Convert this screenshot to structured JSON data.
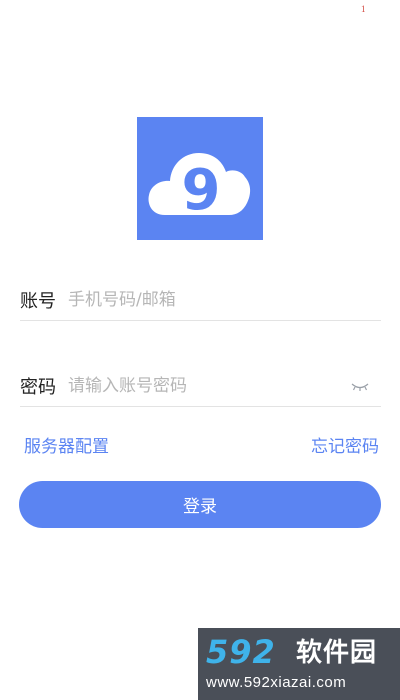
{
  "status": {
    "corner_mark": "1"
  },
  "logo": {
    "icon": "cloud-icon",
    "glyph": "9",
    "color": "#5b84f2"
  },
  "account": {
    "label": "账号",
    "placeholder": "手机号码/邮箱",
    "value": ""
  },
  "password": {
    "label": "密码",
    "placeholder": "请输入账号密码",
    "value": "",
    "toggle_icon": "eye-closed-icon"
  },
  "links": {
    "server_config": "服务器配置",
    "forgot_password": "忘记密码"
  },
  "login_button": {
    "label": "登录"
  },
  "watermark": {
    "logo": "592",
    "name": "软件园",
    "url": "www.592xiazai.com"
  },
  "colors": {
    "accent": "#5b84f2",
    "placeholder": "#b6b6b6",
    "divider": "#e3e3e3"
  }
}
